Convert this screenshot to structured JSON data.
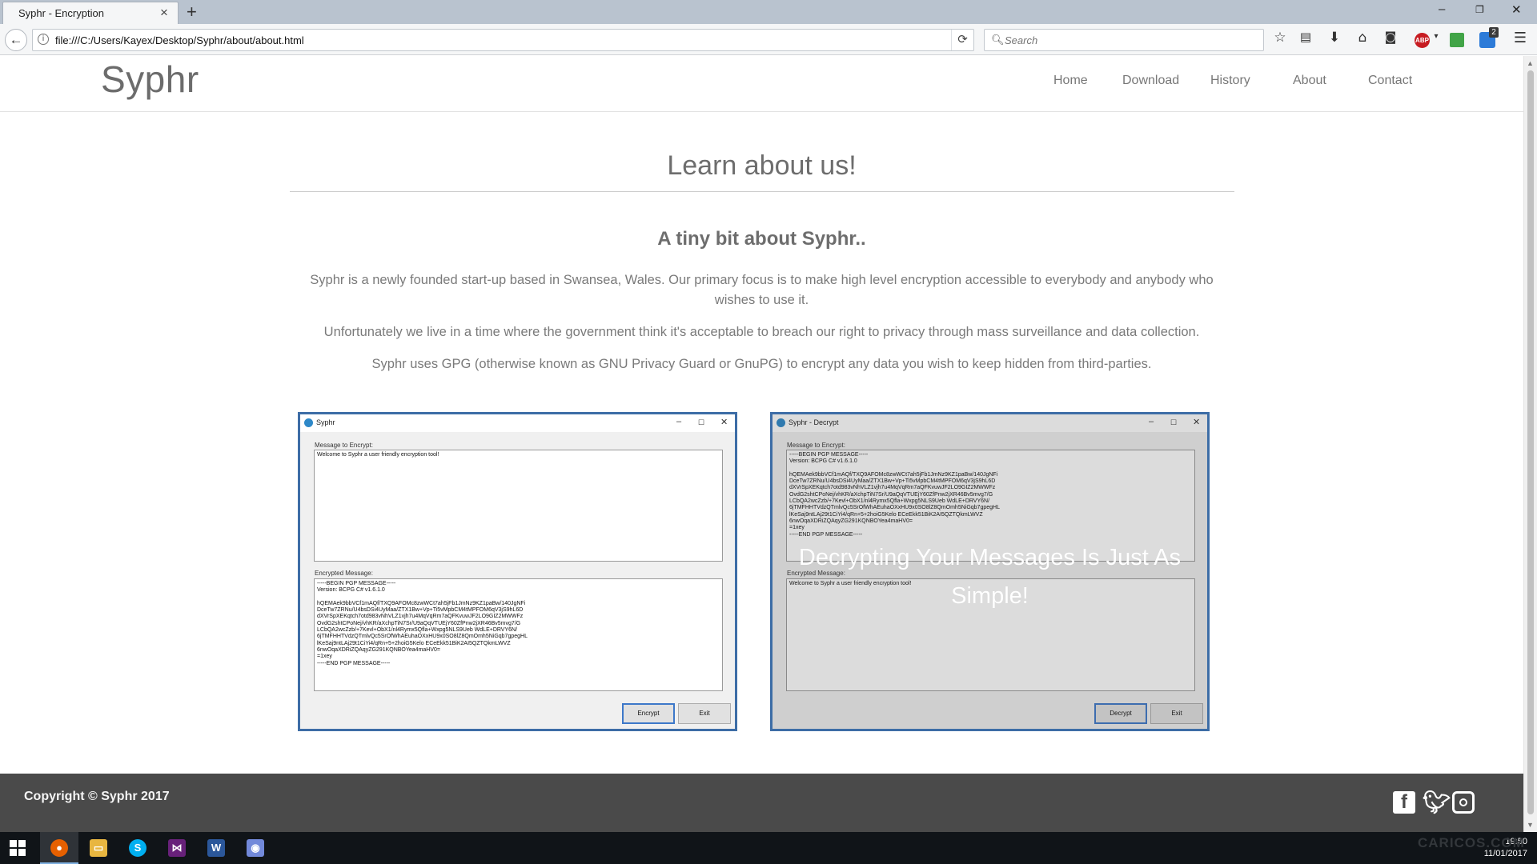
{
  "browser": {
    "tab_title": "Syphr - Encryption",
    "url": "file:///C:/Users/Kayex/Desktop/Syphr/about/about.html",
    "search_placeholder": "Search",
    "ext_badge_count": "2"
  },
  "site": {
    "logo": "Syphr",
    "nav": [
      "Home",
      "Download",
      "History",
      "About",
      "Contact"
    ]
  },
  "main": {
    "title": "Learn about us!",
    "subtitle": "A tiny bit about Syphr..",
    "paragraphs": [
      "Syphr is a newly founded start-up based in Swansea, Wales. Our primary focus is to make high level encryption accessible to everybody and anybody who wishes to use it.",
      "Unfortunately we live in a time where the government think it's acceptable to breach our right to privacy through mass surveillance and data collection.",
      "Syphr uses GPG (otherwise known as GNU Privacy Guard or GnuPG) to encrypt any data you wish to keep hidden from third-parties."
    ]
  },
  "encrypt_window": {
    "title": "Syphr",
    "label_message": "Message to Encrypt:",
    "message": "Welcome to Syphr a user friendly encryption tool!",
    "label_encrypted": "Encrypted Message:",
    "encrypted": "-----BEGIN PGP MESSAGE-----\nVersion: BCPG C# v1.6.1.0\n\nhQEMAek9bbVCf1mAQf/TXQ9AFOMc8zwWCt7ah5jFb1JmNz9KZ1paBw/140JgNFi\nDceTw7ZRNu/U4bsDSi4UyMaa/ZTX1Bw+Vp+Ti5vMpbCM4tMPFOM6qV3jS9hL6D\ndXVrSpXEKqtch7otd983vNhVLZ1vjh7u4MqVqRm7aQFKvuwJF2LO9GIZ2MWWFz\nOvdG2shtCPoNej/vhKR/aXchpTiN7Sr/U9aQqVTUEjY60ZfPnw2jXR46Bv5mvg7/G\nLCbQA2wcZzb/+7Kevl+ObX1/nl4Rymx5Qfla+Wxpg5NLS9Ueb WdLE+DRVY6N/\n6jTMFHHTVdzQTmlvQc5SrOfWhAEuhaOXxHU9x0SO8lZ8QmOmh5NiGqb7gpegHL\nlKeSaj9ntLAj29t1CiYi4/qRn+5+2hoiG5Kelo ECeEkk51BiK2AI5QZTQkmLWVZ\n6nwOqaXDRiZQAqyZG291KQNBOYea4maHV0=\n=1xey\n-----END PGP MESSAGE-----",
    "btn_primary": "Encrypt",
    "btn_exit": "Exit"
  },
  "decrypt_window": {
    "title": "Syphr - Decrypt",
    "label_message": "Message to Encrypt:",
    "message": "-----BEGIN PGP MESSAGE-----\nVersion: BCPG C# v1.6.1.0\n\nhQEMAek9bbVCf1mAQf/TXQ9AFOMc8zwWCt7ah5jFb1JmNz9KZ1paBw/140JgNFi\nDceTw7ZRNu/U4bsDSi4UyMaa/ZTX1Bw+Vp+Ti5vMpbCM4tMPFOM6qV3jS9hL6D\ndXVrSpXEKqtch7otd983vNhVLZ1vjh7u4MqVqRm7aQFKvuwJF2LO9GIZ2MWWFz\nOvdG2shtCPoNej/vhKR/aXchpTiN7Sr/U9aQqVTUEjY60ZfPnw2jXR46Bv5mvg7/G\nLCbQA2wcZzb/+7Kevl+ObX1/nl4Rymx5Qfla+Wxpg5NLS9Ueb WdLE+DRVY6N/\n6jTMFHHTVdzQTmlvQc5SrOfWhAEuhaOXxHU9x0SO8lZ8QmOmh5NiGqb7gpegHL\nlKeSaj9ntLAj29t1CiYi4/qRn+5+2hoiG5Kelo ECeEkk51BiK2AI5QZTQkmLWVZ\n6nwOqaXDRiZQAqyZG291KQNBOYea4maHV0=\n=1xey\n-----END PGP MESSAGE-----",
    "label_encrypted": "Encrypted Message:",
    "encrypted": "Welcome to Syphr a user friendly encryption tool!",
    "btn_primary": "Decrypt",
    "btn_exit": "Exit",
    "overlay": "Decrypting Your Messages Is Just As Simple!"
  },
  "footer": {
    "copyright": "Copyright © Syphr 2017",
    "social": [
      "facebook-icon",
      "twitter-icon",
      "instagram-icon"
    ]
  },
  "taskbar": {
    "apps": [
      "firefox",
      "file-explorer",
      "skype",
      "visual-studio",
      "word",
      "discord"
    ],
    "time": "19:50",
    "date": "11/01/2017",
    "watermark": "CARICOS.COM"
  },
  "colors": {
    "accent_border": "#3d6da6",
    "footer_bg": "#4a4a4a",
    "text_gray": "#7a7a7a"
  }
}
